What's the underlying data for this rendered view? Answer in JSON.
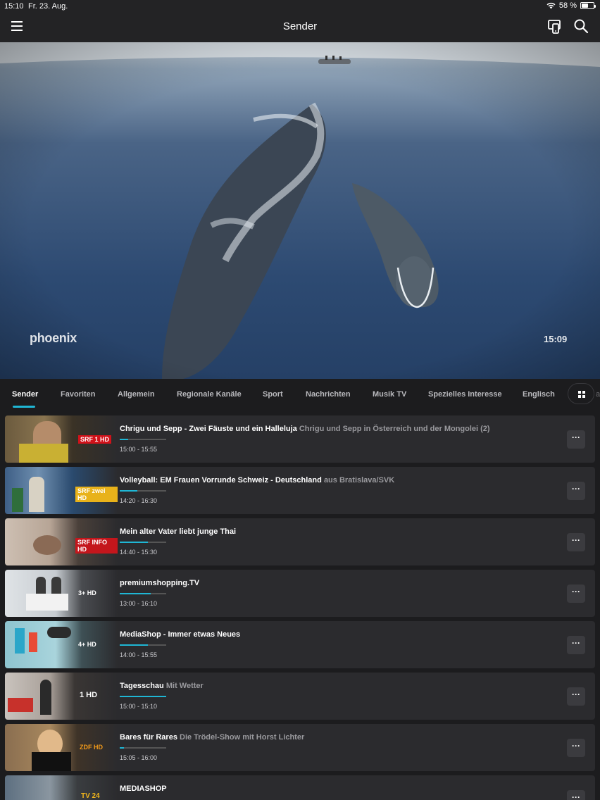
{
  "status_bar": {
    "time": "15:10",
    "date": "Fr. 23. Aug.",
    "battery": "58 %",
    "battery_level": 0.58
  },
  "app_bar": {
    "title": "Sender"
  },
  "player": {
    "channel_logo": "phoenix",
    "clock": "15:09"
  },
  "tabs": [
    {
      "label": "Sender",
      "active": true
    },
    {
      "label": "Favoriten"
    },
    {
      "label": "Allgemein"
    },
    {
      "label": "Regionale Kanäle"
    },
    {
      "label": "Sport"
    },
    {
      "label": "Nachrichten"
    },
    {
      "label": "Musik TV"
    },
    {
      "label": "Spezielles Interesse"
    },
    {
      "label": "Englisch"
    }
  ],
  "tabs_overflow_text": "a",
  "channels": [
    {
      "logo": "SRF 1 HD",
      "title": "Chrigu und Sepp - Zwei Fäuste und ein Halleluja",
      "subtitle": "Chrigu und Sepp in Österreich und der Mongolei (2)",
      "time": "15:00 - 15:55",
      "progress": 0.18
    },
    {
      "logo": "SRF zwei HD",
      "title": "Volleyball: EM Frauen Vorrunde Schweiz - Deutschland",
      "subtitle": "aus Bratislava/SVK",
      "time": "14:20 - 16:30",
      "progress": 0.38
    },
    {
      "logo": "SRF INFO HD",
      "title": "Mein alter Vater liebt junge Thai",
      "subtitle": "",
      "time": "14:40 - 15:30",
      "progress": 0.6
    },
    {
      "logo": "3+ HD",
      "title": "premiumshopping.TV",
      "subtitle": "",
      "time": "13:00 - 16:10",
      "progress": 0.66
    },
    {
      "logo": "4+ HD",
      "title": "MediaShop - Immer etwas Neues",
      "subtitle": "",
      "time": "14:00 - 15:55",
      "progress": 0.61
    },
    {
      "logo": "1 HD",
      "title": "Tagesschau",
      "subtitle": "Mit Wetter",
      "time": "15:00 - 15:10",
      "progress": 1.0
    },
    {
      "logo": "ZDF HD",
      "title": "Bares für Rares",
      "subtitle": "Die Trödel-Show mit Horst Lichter",
      "time": "15:05 - 16:00",
      "progress": 0.09
    },
    {
      "logo": "TV 24",
      "title": "MEDIASHOP",
      "subtitle": "",
      "time": "",
      "progress": 0
    }
  ],
  "more_label": "···",
  "colors": {
    "accent": "#1fb6d4",
    "background": "#1c1c1e",
    "row": "#2b2b2e"
  }
}
